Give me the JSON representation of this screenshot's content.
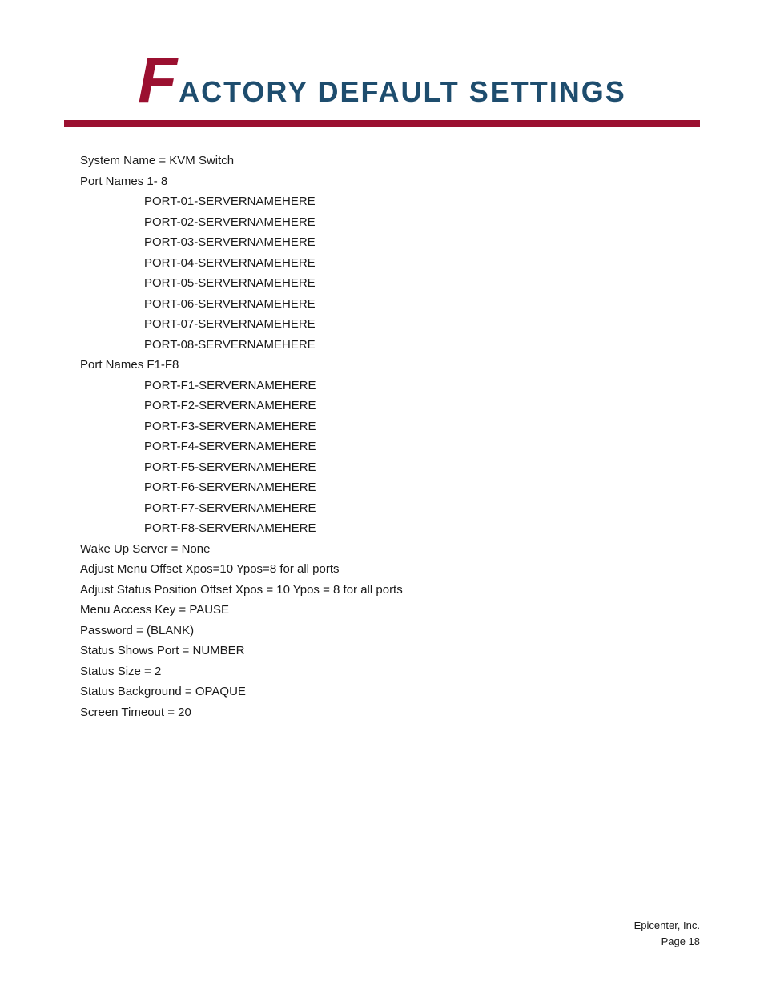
{
  "header": {
    "f_letter": "F",
    "title_rest": "ACTORY DEFAULT SETTINGS"
  },
  "content": {
    "system_name": "System Name = KVM Switch",
    "port_names_label": "Port Names 1- 8",
    "port_names_1_8": [
      "PORT-01-SERVERNAMEHERE",
      "PORT-02-SERVERNAMEHERE",
      "PORT-03-SERVERNAMEHERE",
      "PORT-04-SERVERNAMEHERE",
      "PORT-05-SERVERNAMEHERE",
      "PORT-06-SERVERNAMEHERE",
      "PORT-07-SERVERNAMEHERE",
      "PORT-08-SERVERNAMEHERE"
    ],
    "port_names_f_label": "Port Names F1-F8",
    "port_names_f1_f8": [
      "PORT-F1-SERVERNAMEHERE",
      "PORT-F2-SERVERNAMEHERE",
      "PORT-F3-SERVERNAMEHERE",
      "PORT-F4-SERVERNAMEHERE",
      "PORT-F5-SERVERNAMEHERE",
      "PORT-F6-SERVERNAMEHERE",
      "PORT-F7-SERVERNAMEHERE",
      "PORT-F8-SERVERNAMEHERE"
    ],
    "wake_up_server": "Wake Up Server = None",
    "adjust_menu_offset": "Adjust Menu Offset Xpos=10 Ypos=8 for all ports",
    "adjust_status_position": "Adjust Status Position Offset Xpos = 10 Ypos = 8 for all ports",
    "menu_access_key": "Menu Access Key = PAUSE",
    "password": "Password = (BLANK)",
    "status_shows_port": "Status Shows Port = NUMBER",
    "status_size": "Status Size = 2",
    "status_background": "Status Background = OPAQUE",
    "screen_timeout": "Screen Timeout = 20"
  },
  "footer": {
    "company": "Epicenter, Inc.",
    "page": "Page 18"
  }
}
